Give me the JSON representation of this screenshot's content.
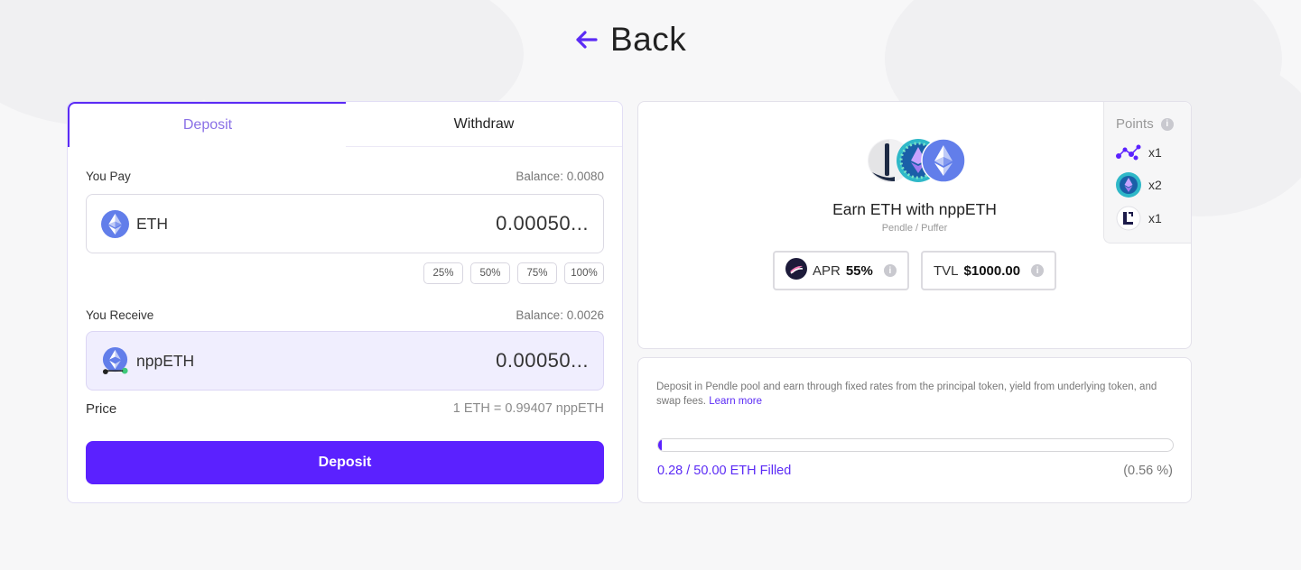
{
  "nav": {
    "back_label": "Back"
  },
  "tabs": [
    {
      "label": "Deposit",
      "active": true
    },
    {
      "label": "Withdraw",
      "active": false
    }
  ],
  "pay": {
    "label": "You Pay",
    "balance": "Balance: 0.0080",
    "token": "ETH",
    "amount": "0.00050..."
  },
  "percent_buttons": [
    "25%",
    "50%",
    "75%",
    "100%"
  ],
  "receive": {
    "label": "You Receive",
    "balance": "Balance: 0.0026",
    "token": "nppETH",
    "amount": "0.00050..."
  },
  "price": {
    "label": "Price",
    "value": "1 ETH = 0.99407 nppETH"
  },
  "deposit_button": "Deposit",
  "pool": {
    "title": "Earn ETH with nppETH",
    "subtitle": "Pendle / Puffer",
    "apr_label": "APR",
    "apr_value": "55%",
    "tvl_label": "TVL",
    "tvl_value": "$1000.00"
  },
  "points": {
    "title": "Points",
    "items": [
      {
        "icon": "network-nodes-icon",
        "multiplier": "x1"
      },
      {
        "icon": "puffer-eth-icon",
        "multiplier": "x2"
      },
      {
        "icon": "l-logo-icon",
        "multiplier": "x1"
      }
    ]
  },
  "info": {
    "description": "Deposit in Pendle pool and earn through fixed rates from the principal token, yield from underlying token, and swap fees.",
    "learn_more": "Learn more",
    "fill_fraction": 0.0056,
    "filled_text": "0.28 / 50.00 ETH Filled",
    "filled_pct": "(0.56 %)"
  },
  "colors": {
    "accent": "#5b21ff",
    "tab_active_text": "#8a70e6",
    "eth": "#627eea"
  }
}
